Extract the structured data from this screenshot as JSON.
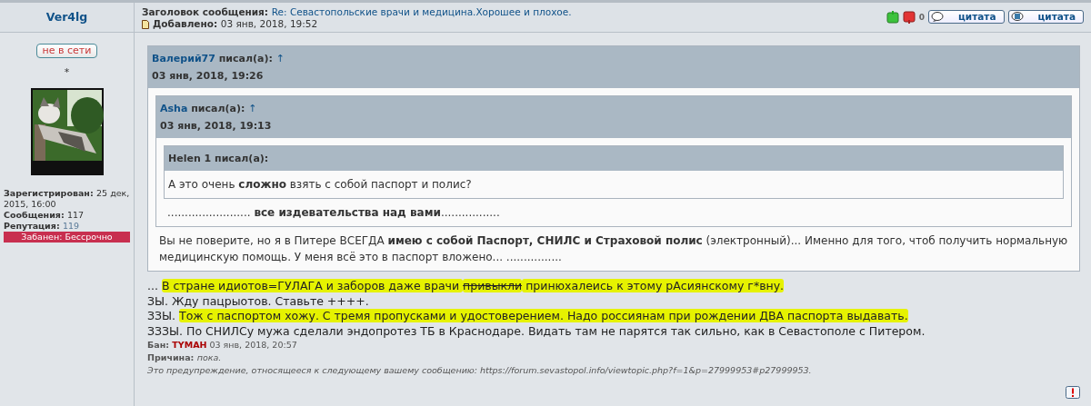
{
  "author": {
    "name": "Ver4lg",
    "status": "не в сети",
    "rank": "*",
    "profile": [
      {
        "label": "Зарегистрирован:",
        "value": "25 дек, 2015, 16:00",
        "link": false
      },
      {
        "label": "Сообщения:",
        "value": "117",
        "link": false
      },
      {
        "label": "Репутация:",
        "value": "119",
        "link": true
      }
    ],
    "ban_badge": "Забанен: Бессрочно"
  },
  "header": {
    "subject_label": "Заголовок сообщения:",
    "subject": "Re: Севастопольские врачи и медицина.Хорошее и плохое.",
    "added_label": "Добавлено:",
    "added": "03 янв, 2018, 19:52",
    "rating": "0",
    "buttons": [
      "цитата",
      "цитата"
    ]
  },
  "quote": {
    "author": "Валерий77",
    "author_link": true,
    "wrote": "писал(а):",
    "arrow": "↑",
    "date": "03 янв, 2018, 19:26",
    "content": [
      {
        "kind": "quote",
        "quote": {
          "author": "Asha",
          "author_link": true,
          "wrote": "писал(а):",
          "arrow": "↑",
          "date": "03 янв, 2018, 19:13",
          "content": [
            {
              "kind": "quote",
              "quote": {
                "author": "Helen 1",
                "author_link": false,
                "wrote": "писал(а):",
                "content": [
                  {
                    "kind": "paragraph",
                    "text": "А это очень **сложно** взять с собой паспорт и полис?"
                  }
                ]
              }
            },
            {
              "kind": "paragraph",
              "text": "........................ **все издевательства над вами**................."
            }
          ]
        }
      },
      {
        "kind": "paragraph",
        "text": "Вы не поверите, но я в Питере ВСЕГДА **имею с собой Паспорт, СНИЛС и Страховой полис** (электронный)... Именно для того, чтоб получить нормальную медицинскую помощь. У меня всё это в паспорт вложено... ................"
      }
    ]
  },
  "lines": [
    [
      {
        "text": "... ",
        "highlight": false,
        "strike": false
      },
      {
        "text": "В стране идиотов=ГУЛАГА и заборов даже врачи ",
        "highlight": true,
        "strike": false
      },
      {
        "text": "привыкли",
        "highlight": true,
        "strike": true
      },
      {
        "text": " принюхалеись к этому рАсиянскому г*вну.",
        "highlight": true,
        "strike": false
      }
    ],
    [
      {
        "text": "ЗЫ. Жду пацрыотов. Ставьте ++++.",
        "highlight": false,
        "strike": false
      }
    ],
    [
      {
        "text": "ЗЗЫ. ",
        "highlight": false,
        "strike": false
      },
      {
        "text": "Тож с паспортом хожу. С тремя пропусками и удостоверением. Надо россиянам при рождении ДВА паспорта выдавать.",
        "highlight": true,
        "strike": false
      }
    ],
    [
      {
        "text": "ЗЗЗЫ. По СНИЛСу мужа сделали эндопротез ТБ в Краснодаре. Видать там не парятся так сильно, как в Севастополе с Питером.",
        "highlight": false,
        "strike": false
      }
    ]
  ],
  "ban": {
    "label": "Бан:",
    "moderator": "TYMAH",
    "date": "03 янв, 2018, 20:57",
    "reason_label": "Причина:",
    "reason": "пока.",
    "note": "Это предупреждение, относящееся к следующему вашему сообщению: https://forum.sevastopol.info/viewtopic.php?f=1&p=27999953#p27999953."
  }
}
